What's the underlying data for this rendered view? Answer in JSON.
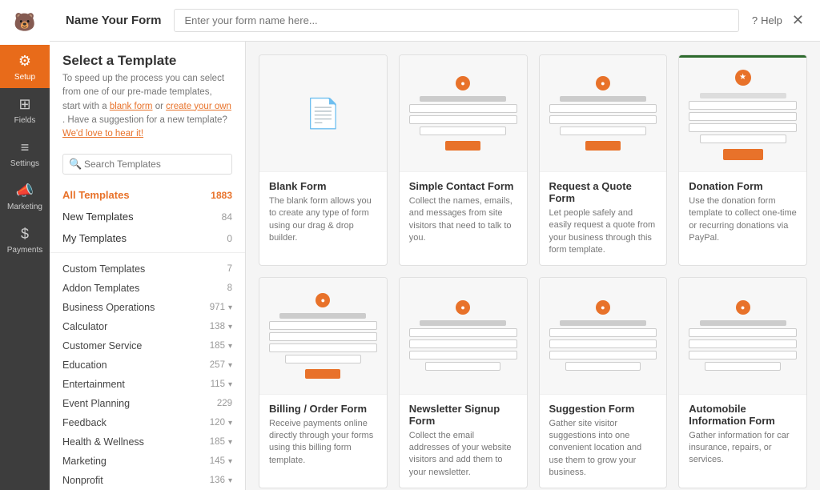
{
  "sidebar": {
    "logo": "🐻",
    "items": [
      {
        "label": "Setup",
        "icon": "⚙",
        "active": true
      },
      {
        "label": "Fields",
        "icon": "⊞",
        "active": false
      },
      {
        "label": "Settings",
        "icon": "≡",
        "active": false
      },
      {
        "label": "Marketing",
        "icon": "📣",
        "active": false
      },
      {
        "label": "Payments",
        "icon": "$",
        "active": false
      }
    ]
  },
  "topbar": {
    "title": "Name Your Form",
    "placeholder": "Enter your form name here...",
    "help": "Help",
    "close": "✕"
  },
  "leftpanel": {
    "section_title": "Select a Template",
    "section_desc_pre": "To speed up the process you can select from one of our pre-made templates, start with a ",
    "blank_form_link": "blank form",
    "section_desc_mid": " or ",
    "create_own_link": "create your own",
    "section_desc_post": ". Have a suggestion for a new template? ",
    "suggestion_link": "We'd love to hear it!",
    "search_placeholder": "Search Templates",
    "nav": [
      {
        "label": "All Templates",
        "count": "1883",
        "active": true
      },
      {
        "label": "New Templates",
        "count": "84",
        "active": false
      },
      {
        "label": "My Templates",
        "count": "0",
        "active": false
      }
    ],
    "categories": [
      {
        "label": "Custom Templates",
        "count": "7",
        "has_chevron": false
      },
      {
        "label": "Addon Templates",
        "count": "8",
        "has_chevron": false
      },
      {
        "label": "Business Operations",
        "count": "971",
        "has_chevron": true
      },
      {
        "label": "Calculator",
        "count": "138",
        "has_chevron": true
      },
      {
        "label": "Customer Service",
        "count": "185",
        "has_chevron": true
      },
      {
        "label": "Education",
        "count": "257",
        "has_chevron": true
      },
      {
        "label": "Entertainment",
        "count": "115",
        "has_chevron": true
      },
      {
        "label": "Event Planning",
        "count": "229",
        "has_chevron": false
      },
      {
        "label": "Feedback",
        "count": "120",
        "has_chevron": true
      },
      {
        "label": "Health & Wellness",
        "count": "185",
        "has_chevron": true
      },
      {
        "label": "Marketing",
        "count": "145",
        "has_chevron": true
      },
      {
        "label": "Nonprofit",
        "count": "136",
        "has_chevron": true
      }
    ]
  },
  "templates": [
    {
      "name": "Blank Form",
      "desc": "The blank form allows you to create any type of form using our drag & drop builder.",
      "type": "blank"
    },
    {
      "name": "Simple Contact Form",
      "desc": "Collect the names, emails, and messages from site visitors that need to talk to you.",
      "type": "contact"
    },
    {
      "name": "Request a Quote Form",
      "desc": "Let people safely and easily request a quote from your business through this form template.",
      "type": "quote"
    },
    {
      "name": "Donation Form",
      "desc": "Use the donation form template to collect one-time or recurring donations via PayPal.",
      "type": "donation"
    },
    {
      "name": "Billing / Order Form",
      "desc": "Receive payments online directly through your forms using this billing form template.",
      "type": "billing"
    },
    {
      "name": "Newsletter Signup Form",
      "desc": "Collect the email addresses of your website visitors and add them to your newsletter.",
      "type": "newsletter"
    },
    {
      "name": "Suggestion Form",
      "desc": "Gather site visitor suggestions into one convenient location and use them to grow your business.",
      "type": "suggestion"
    },
    {
      "name": "Automobile Information Form",
      "desc": "Gather information for car insurance, repairs, or services.",
      "type": "automobile"
    }
  ]
}
